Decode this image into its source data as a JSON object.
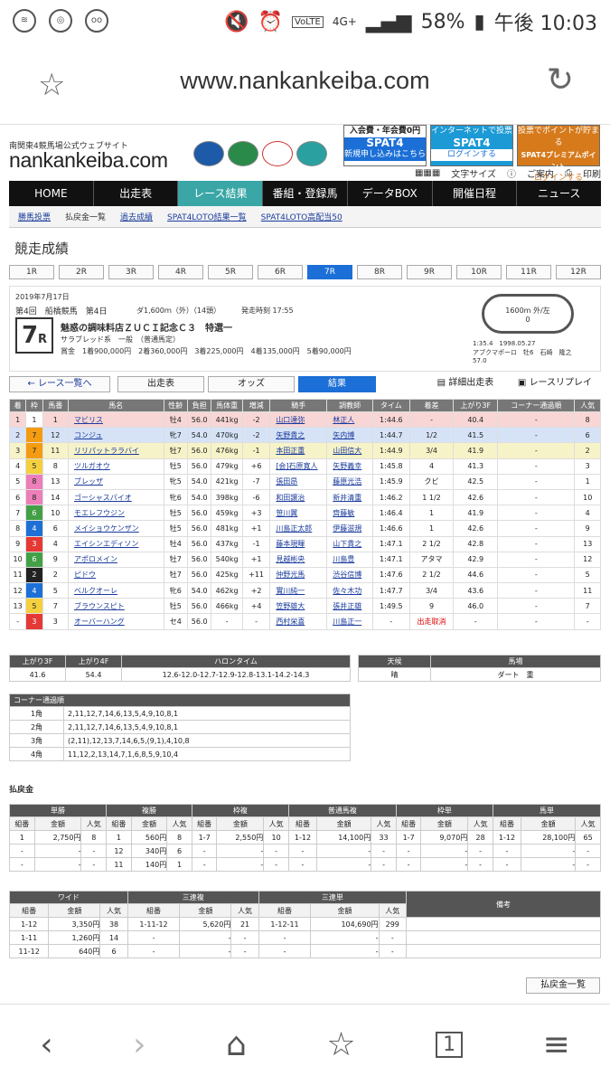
{
  "status": {
    "notif1": "ON",
    "notif2": "ON",
    "battery": "58%",
    "time": "午後 10:03",
    "network": "4G+",
    "volte": "VoLTE"
  },
  "browser": {
    "url": "www.nankankeiba.com"
  },
  "site": {
    "tagline": "南関東4競馬場公式ウェブサイト",
    "logo": "nankankeiba.com",
    "ads": [
      {
        "top": "入会費・年会費0円",
        "main": "SPAT4",
        "bottom": "新規申し込みはこちら"
      },
      {
        "top": "インターネットで投票",
        "main": "SPAT4",
        "bottom": "ログインする"
      },
      {
        "top": "投票でポイントが貯まる",
        "main": "SPAT4プレミアムポイント",
        "bottom": "ログインする"
      }
    ],
    "tools": [
      "文字サイズ",
      "ご案内",
      "印刷"
    ]
  },
  "nav": [
    "HOME",
    "出走表",
    "レース結果",
    "番組・登録馬",
    "データBOX",
    "開催日程",
    "ニュース"
  ],
  "subnav": [
    "勝馬投票",
    "払戻金一覧",
    "過去成績",
    "SPAT4LOTO結果一覧",
    "SPAT4LOTO高配当50"
  ],
  "page_title": "競走成績",
  "races": [
    "1R",
    "2R",
    "3R",
    "4R",
    "5R",
    "6R",
    "7R",
    "8R",
    "9R",
    "10R",
    "11R",
    "12R"
  ],
  "race": {
    "date": "2019年7月17日",
    "meet": "第4回　船橋競馬　第4日",
    "dist": "ダ1,600ｍ（外）（14頭）",
    "start": "発走時刻 17:55",
    "number": "7",
    "r": "R",
    "name": "魅惑の調味料店ＺＵＣＩ記念Ｃ３　特選一",
    "cond": "サラブレッド系　一般　（普通馬定）",
    "prize": "賞金　1着900,000円　2着360,000円　3着225,000円　4着135,000円　5着90,000円",
    "course": "1600m  外/左",
    "course0": "0",
    "record1": "1:35.4　1998.05.27",
    "record2": "アブクマポーロ　牡6　石崎　隆之",
    "record3": "57.0"
  },
  "buttons": [
    "← レース一覧へ",
    "出走表",
    "オッズ",
    "結果",
    "詳細出走表",
    "レースリプレイ"
  ],
  "results": {
    "headers": [
      "着",
      "枠",
      "馬番",
      "馬名",
      "性齢",
      "負担",
      "馬体重",
      "増減",
      "騎手",
      "調教師",
      "タイム",
      "着差",
      "上がり3F",
      "コーナー通過順",
      "人気"
    ],
    "rows": [
      [
        "1",
        "1",
        "1",
        "マビリス",
        "牡4",
        "56.0",
        "441kg",
        "-2",
        "山口達弥",
        "林正人",
        "1:44.6",
        "-",
        "40.4",
        "-",
        "8"
      ],
      [
        "2",
        "7",
        "12",
        "コンジュ",
        "牝7",
        "54.0",
        "470kg",
        "-2",
        "矢野貴之",
        "矢内博",
        "1:44.7",
        "1/2",
        "41.5",
        "-",
        "6"
      ],
      [
        "3",
        "7",
        "11",
        "リリパットララバイ",
        "牡7",
        "56.0",
        "476kg",
        "-1",
        "本田正重",
        "山田信大",
        "1:44.9",
        "3/4",
        "41.9",
        "-",
        "2"
      ],
      [
        "4",
        "5",
        "8",
        "ツルガオウ",
        "牡5",
        "56.0",
        "479kg",
        "+6",
        "[会]石原寛人",
        "矢野義幸",
        "1:45.8",
        "4",
        "41.3",
        "-",
        "3"
      ],
      [
        "5",
        "8",
        "13",
        "ブレッザ",
        "牝5",
        "54.0",
        "421kg",
        "-7",
        "張田昂",
        "藤原光浩",
        "1:45.9",
        "クビ",
        "42.5",
        "-",
        "1"
      ],
      [
        "6",
        "8",
        "14",
        "ゴーシャスパイオ",
        "牝6",
        "54.0",
        "398kg",
        "-6",
        "和田譲治",
        "新井清重",
        "1:46.2",
        "1 1/2",
        "42.6",
        "-",
        "10"
      ],
      [
        "7",
        "6",
        "10",
        "モエレフウジン",
        "牡5",
        "56.0",
        "459kg",
        "+3",
        "笹川翼",
        "齊藤敏",
        "1:46.4",
        "1",
        "41.9",
        "-",
        "4"
      ],
      [
        "8",
        "4",
        "6",
        "メイショウケンザン",
        "牡5",
        "56.0",
        "481kg",
        "+1",
        "川島正太郎",
        "伊藤滋規",
        "1:46.6",
        "1",
        "42.6",
        "-",
        "9"
      ],
      [
        "9",
        "3",
        "4",
        "エイシンエディソン",
        "牡4",
        "56.0",
        "437kg",
        "-1",
        "藤本現暉",
        "山下貴之",
        "1:47.1",
        "2 1/2",
        "42.8",
        "-",
        "13"
      ],
      [
        "10",
        "6",
        "9",
        "アポロメイン",
        "牡7",
        "56.0",
        "540kg",
        "+1",
        "見越彬央",
        "川島豊",
        "1:47.1",
        "アタマ",
        "42.9",
        "-",
        "12"
      ],
      [
        "11",
        "2",
        "2",
        "ピドウ",
        "牡7",
        "56.0",
        "425kg",
        "+11",
        "仲野光馬",
        "渋谷信博",
        "1:47.6",
        "2 1/2",
        "44.6",
        "-",
        "5"
      ],
      [
        "12",
        "4",
        "5",
        "ベルクオーレ",
        "牝6",
        "54.0",
        "462kg",
        "+2",
        "實川純一",
        "佐々木功",
        "1:47.7",
        "3/4",
        "43.6",
        "-",
        "11"
      ],
      [
        "13",
        "5",
        "7",
        "ブラウンスピト",
        "牡5",
        "56.0",
        "466kg",
        "+4",
        "笠野雄大",
        "張井正雄",
        "1:49.5",
        "9",
        "46.0",
        "-",
        "7"
      ],
      [
        "-",
        "3",
        "3",
        "オーバーハング",
        "セ4",
        "56.0",
        "-",
        "-",
        "西村栄喜",
        "川島正一",
        "-",
        "出走取消",
        "-",
        "-",
        "-"
      ]
    ]
  },
  "halon": {
    "headers": [
      "上がり3F",
      "上がり4F",
      "ハロンタイム"
    ],
    "values": [
      "41.6",
      "54.4",
      "12.6-12.0-12.7-12.9-12.8-13.1-14.2-14.3"
    ]
  },
  "weather": {
    "headers": [
      "天候",
      "馬場"
    ],
    "values": [
      "晴",
      "ダート　重"
    ]
  },
  "corner": {
    "title": "コーナー通過順",
    "rows": [
      [
        "1角",
        "2,11,12,7,14,6,13,5,4,9,10,8,1"
      ],
      [
        "2角",
        "2,11,12,7,14,6,13,5,4,9,10,8,1"
      ],
      [
        "3角",
        "(2,11),12,13,7,14,6,5,(9,1),4,10,8"
      ],
      [
        "4角",
        "11,12,2,13,14,7,1,6,8,5,9,10,4"
      ]
    ]
  },
  "payout_title": "払戻金",
  "payout": {
    "groups": [
      "単勝",
      "複勝",
      "枠複",
      "普通馬複",
      "枠単",
      "馬単"
    ],
    "sub": [
      "組番",
      "金額",
      "人気"
    ],
    "rows": [
      [
        "1",
        "2,750円",
        "8",
        "1",
        "560円",
        "8",
        "1-7",
        "2,550円",
        "10",
        "1-12",
        "14,100円",
        "33",
        "1-7",
        "9,070円",
        "28",
        "1-12",
        "28,100円",
        "65"
      ],
      [
        "-",
        "-",
        "-",
        "12",
        "340円",
        "6",
        "-",
        "-",
        "-",
        "-",
        "-",
        "-",
        "-",
        "-",
        "-",
        "-",
        "-",
        "-"
      ],
      [
        "-",
        "-",
        "-",
        "11",
        "140円",
        "1",
        "-",
        "-",
        "-",
        "-",
        "-",
        "-",
        "-",
        "-",
        "-",
        "-",
        "-",
        "-"
      ]
    ]
  },
  "payout2": {
    "groups": [
      "ワイド",
      "三連複",
      "三連単",
      "備考"
    ],
    "sub": [
      "組番",
      "金額",
      "人気"
    ],
    "rows": [
      [
        "1-12",
        "3,350円",
        "38",
        "1-11-12",
        "5,620円",
        "21",
        "1-12-11",
        "104,690円",
        "299"
      ],
      [
        "1-11",
        "1,260円",
        "14",
        "-",
        "-",
        "-",
        "-",
        "-",
        "-"
      ],
      [
        "11-12",
        "640円",
        "6",
        "-",
        "-",
        "-",
        "-",
        "-",
        "-"
      ]
    ]
  },
  "payout_list_button": "払戻金一覧",
  "colors": {
    "w1": "#ffffff",
    "w2": "#222222",
    "w3": "#e53935",
    "w4": "#1e6fd6",
    "w5": "#f4d03f",
    "w6": "#43a047",
    "w7": "#f39c12",
    "w8": "#ec7fb9"
  }
}
